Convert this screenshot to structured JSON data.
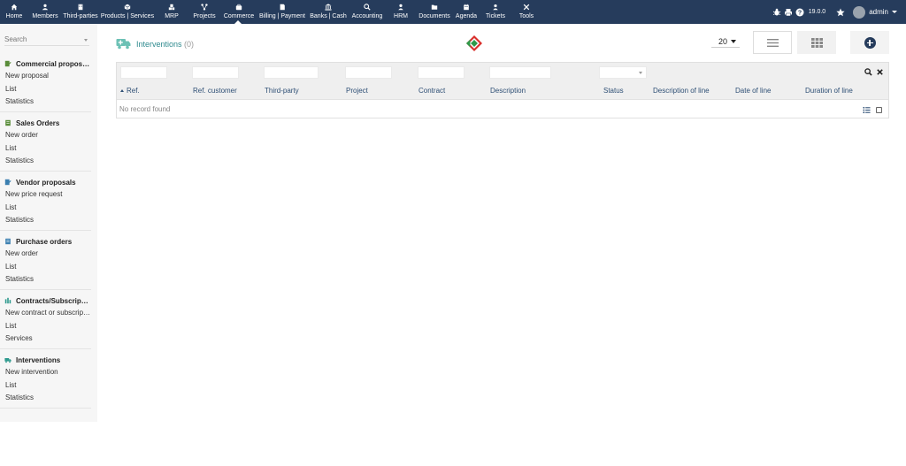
{
  "topmenu": {
    "items": [
      {
        "label": "Home",
        "icon": "home-icon"
      },
      {
        "label": "Members",
        "icon": "member-icon"
      },
      {
        "label": "Third-parties",
        "icon": "building-icon"
      },
      {
        "label": "Products | Services",
        "icon": "cube-icon"
      },
      {
        "label": "MRP",
        "icon": "cubes-icon"
      },
      {
        "label": "Projects",
        "icon": "project-icon"
      },
      {
        "label": "Commerce",
        "icon": "briefcase-icon"
      },
      {
        "label": "Billing | Payment",
        "icon": "invoice-icon"
      },
      {
        "label": "Banks | Cash",
        "icon": "bank-icon"
      },
      {
        "label": "Accounting",
        "icon": "search-dollar-icon"
      },
      {
        "label": "HRM",
        "icon": "user-icon"
      },
      {
        "label": "Documents",
        "icon": "folder-icon"
      },
      {
        "label": "Agenda",
        "icon": "calendar-icon"
      },
      {
        "label": "Tickets",
        "icon": "ticket-icon"
      },
      {
        "label": "Tools",
        "icon": "tools-icon"
      }
    ],
    "active": "Commerce"
  },
  "topright": {
    "version": "19.0.0",
    "username": "admin"
  },
  "sidebar": {
    "search_placeholder": "Search",
    "blocks": [
      {
        "title": "Commercial proposals",
        "icon": "proposal-icon",
        "links": [
          "New proposal",
          "List",
          "Statistics"
        ]
      },
      {
        "title": "Sales Orders",
        "icon": "order-icon",
        "links": [
          "New order",
          "List",
          "Statistics"
        ]
      },
      {
        "title": "Vendor proposals",
        "icon": "vendor-proposal-icon",
        "links": [
          "New price request",
          "List",
          "Statistics"
        ]
      },
      {
        "title": "Purchase orders",
        "icon": "purchase-order-icon",
        "links": [
          "New order",
          "List",
          "Statistics"
        ]
      },
      {
        "title": "Contracts/Subscriptions",
        "icon": "contract-icon",
        "links": [
          "New contract or subscription",
          "List",
          "Services"
        ]
      },
      {
        "title": "Interventions",
        "icon": "intervention-icon",
        "links": [
          "New intervention",
          "List",
          "Statistics"
        ]
      }
    ]
  },
  "main": {
    "title": "Interventions",
    "count": "(0)",
    "limit": "20",
    "columns": [
      "Ref.",
      "Ref. customer",
      "Third-party",
      "Project",
      "Contract",
      "Description",
      "Status",
      "Description of line",
      "Date of line",
      "Duration of line"
    ],
    "empty_text": "No record found"
  },
  "colors": {
    "topbar": "#263c5c",
    "title": "#2e8a8e",
    "column_header": "#2e4f75"
  }
}
